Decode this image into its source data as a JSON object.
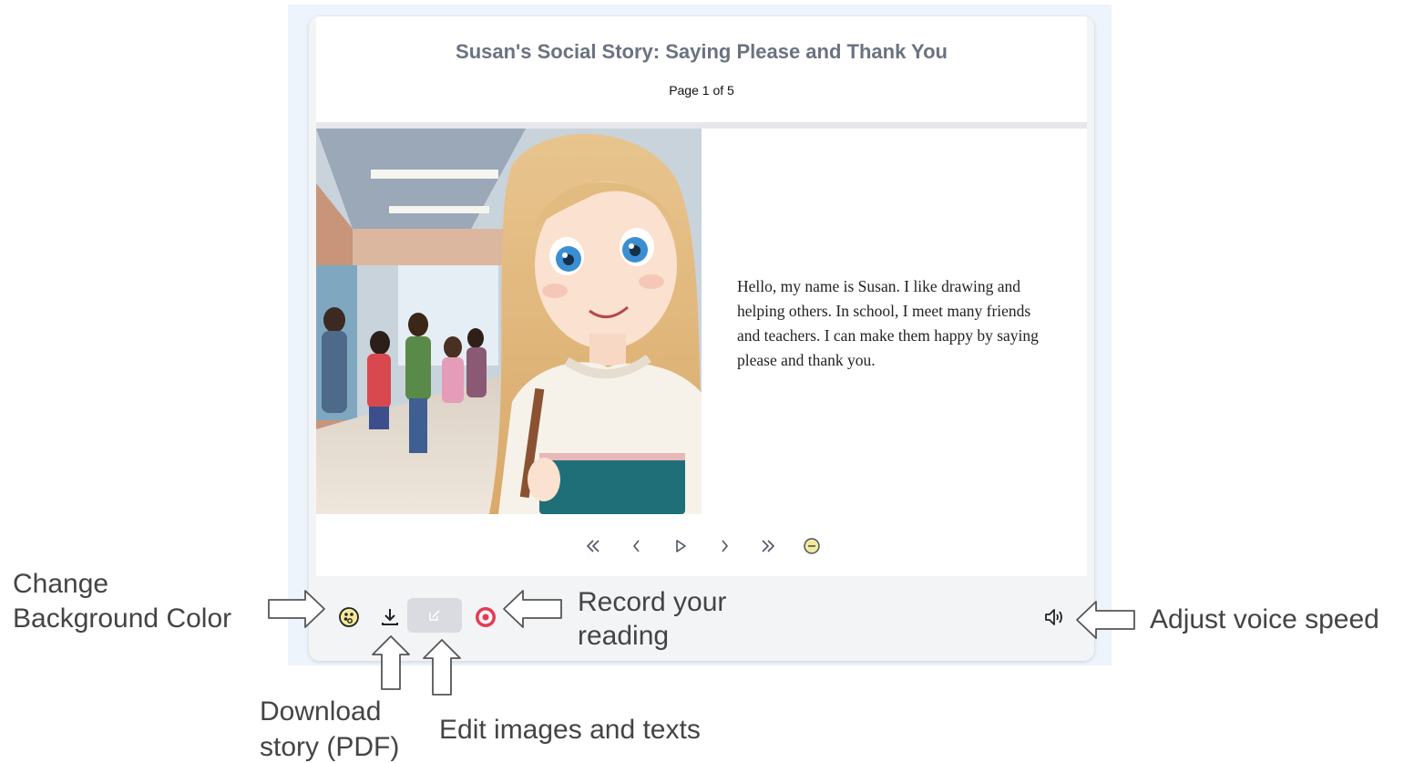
{
  "story": {
    "title": "Susan's Social Story: Saying Please and Thank You",
    "page_indicator": "Page 1 of 5",
    "text": "Hello, my name is Susan. I like drawing and helping others. In school, I meet many friends and teachers. I can make them happy by saying please and thank you."
  },
  "player_controls": [
    {
      "name": "first-page-button",
      "icon": "chevrons-double-left-icon"
    },
    {
      "name": "previous-page-button",
      "icon": "chevron-left-icon"
    },
    {
      "name": "play-button",
      "icon": "play-icon"
    },
    {
      "name": "next-page-button",
      "icon": "chevron-right-icon"
    },
    {
      "name": "last-page-button",
      "icon": "chevrons-double-right-icon"
    },
    {
      "name": "collapse-button",
      "icon": "minus-circle-icon"
    }
  ],
  "toolbar": {
    "icons": [
      "palette-icon",
      "download-icon",
      "edit-icon",
      "record-icon",
      "speaker-icon"
    ]
  },
  "annotations": {
    "background_color_line1": "Change",
    "background_color_line2": "Background Color",
    "record_line1": "Record your",
    "record_line2": "reading",
    "voice_speed": "Adjust voice speed",
    "download_line1": "Download",
    "download_line2": "story (PDF)",
    "edit": "Edit images and texts"
  },
  "colors": {
    "title_gray": "#6b7280",
    "record_red": "#e63a52",
    "palette_yellow": "#f4e99a",
    "edit_button_bg": "#d9dbe0"
  }
}
